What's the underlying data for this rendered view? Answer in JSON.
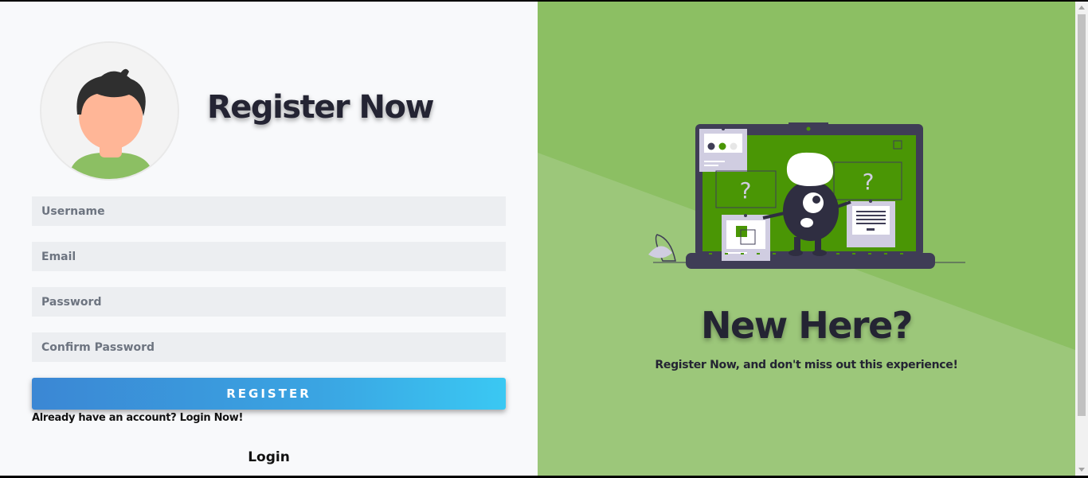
{
  "register": {
    "title": "Register Now",
    "fields": {
      "username_placeholder": "Username",
      "email_placeholder": "Email",
      "password_placeholder": "Password",
      "confirm_placeholder": "Confirm Password"
    },
    "button_label": "REGISTER",
    "already_text": "Already have an account? ",
    "login_now_link": "Login Now!",
    "login_label": "Login"
  },
  "promo": {
    "heading": "New Here?",
    "subtext": "Register Now, and don't miss out this experience!"
  },
  "colors": {
    "left_bg": "#f8f9fb",
    "right_bg": "#8cbf63",
    "accent_green": "#4a9605",
    "button_gradient_start": "#3b87d4",
    "button_gradient_end": "#3ac8f3",
    "dark_text": "#242433"
  },
  "icons": {
    "avatar": "user-avatar-illustration",
    "illustration": "laptop-monster-illustration"
  }
}
